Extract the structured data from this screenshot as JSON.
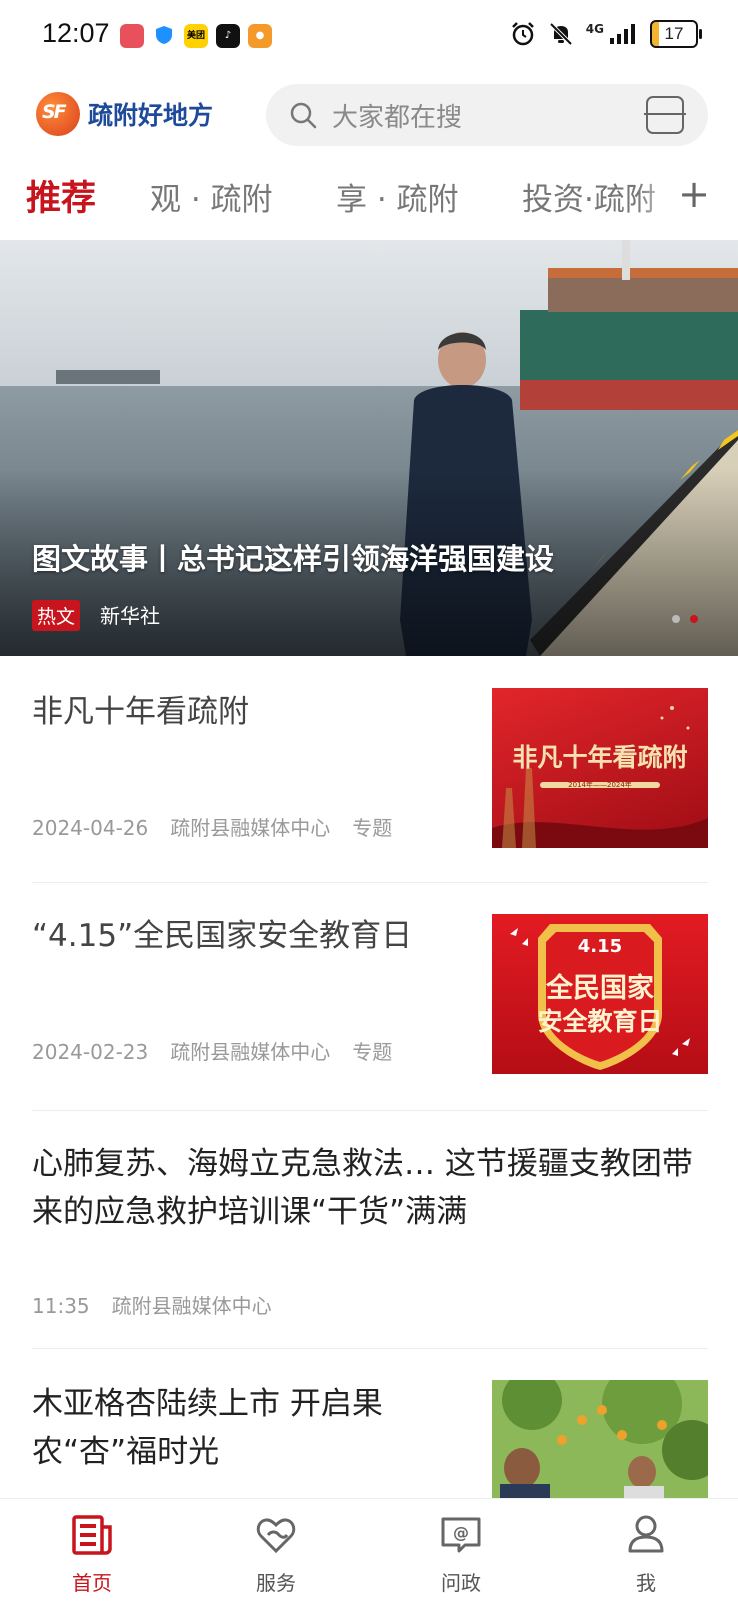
{
  "status_bar": {
    "time": "12:07",
    "network": "4G",
    "battery": "17",
    "battery_level": 0.17,
    "app_icons": [
      "notes-app-icon",
      "shield-app-icon",
      "meituan-app-icon",
      "tiktok-app-icon",
      "message-app-icon"
    ],
    "meituan_label": "美团"
  },
  "header": {
    "logo_text": "疏附好地方",
    "search_placeholder": "大家都在搜"
  },
  "tabs": [
    {
      "label": "推荐",
      "active": true
    },
    {
      "label": "观 · 疏附",
      "active": false
    },
    {
      "label": "享 · 疏附",
      "active": false
    },
    {
      "label": "投资·疏附",
      "active": false
    }
  ],
  "tabs_plus": "+",
  "hero": {
    "title": "图文故事丨总书记这样引领海洋强国建设",
    "tag": "热文",
    "source": "新华社"
  },
  "news": [
    {
      "title": "非凡十年看疏附",
      "date": "2024-04-26",
      "source": "疏附县融媒体中心",
      "type": "专题",
      "thumb_text": "非凡十年看疏附",
      "thumb_sub": "2014年——2024年"
    },
    {
      "title": "“4.15”全民国家安全教育日",
      "date": "2024-02-23",
      "source": "疏附县融媒体中心",
      "type": "专题",
      "thumb_badge": "4.15",
      "thumb_line1": "全民国家",
      "thumb_line2": "安全教育日"
    },
    {
      "title": "心肺复苏、海姆立克急救法… 这节援疆支教团带来的应急救护培训课“干货”满满",
      "date": "11:35",
      "source": "疏附县融媒体中心"
    },
    {
      "title": "木亚格杏陆续上市 开启果农“杏”福时光"
    }
  ],
  "bottom_nav": [
    {
      "label": "首页",
      "icon": "news-icon",
      "active": true
    },
    {
      "label": "服务",
      "icon": "heart-service-icon",
      "active": false
    },
    {
      "label": "问政",
      "icon": "chat-at-icon",
      "active": false
    },
    {
      "label": "我",
      "icon": "user-icon",
      "active": false
    }
  ],
  "colors": {
    "accent": "#c8151d",
    "logo_blue": "#1e4a9a"
  }
}
